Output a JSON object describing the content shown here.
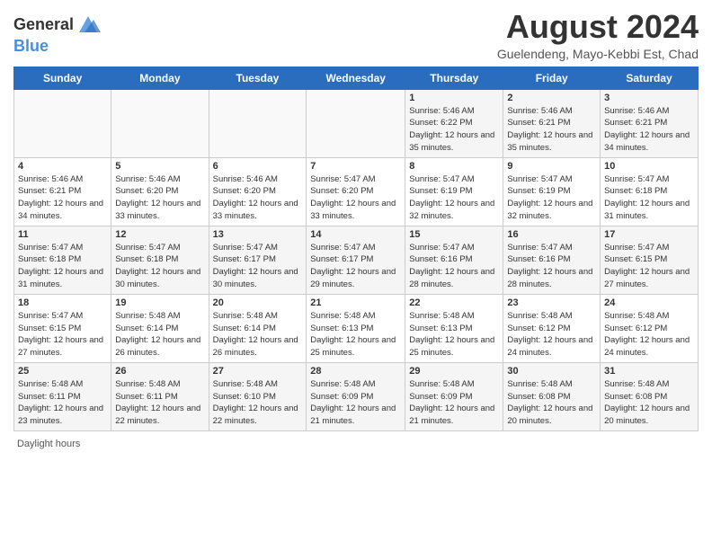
{
  "header": {
    "logo_line1": "General",
    "logo_line2": "Blue",
    "month": "August 2024",
    "location": "Guelendeng, Mayo-Kebbi Est, Chad"
  },
  "weekdays": [
    "Sunday",
    "Monday",
    "Tuesday",
    "Wednesday",
    "Thursday",
    "Friday",
    "Saturday"
  ],
  "weeks": [
    [
      {
        "day": "",
        "info": ""
      },
      {
        "day": "",
        "info": ""
      },
      {
        "day": "",
        "info": ""
      },
      {
        "day": "",
        "info": ""
      },
      {
        "day": "1",
        "info": "Sunrise: 5:46 AM\nSunset: 6:22 PM\nDaylight: 12 hours and 35 minutes."
      },
      {
        "day": "2",
        "info": "Sunrise: 5:46 AM\nSunset: 6:21 PM\nDaylight: 12 hours and 35 minutes."
      },
      {
        "day": "3",
        "info": "Sunrise: 5:46 AM\nSunset: 6:21 PM\nDaylight: 12 hours and 34 minutes."
      }
    ],
    [
      {
        "day": "4",
        "info": "Sunrise: 5:46 AM\nSunset: 6:21 PM\nDaylight: 12 hours and 34 minutes."
      },
      {
        "day": "5",
        "info": "Sunrise: 5:46 AM\nSunset: 6:20 PM\nDaylight: 12 hours and 33 minutes."
      },
      {
        "day": "6",
        "info": "Sunrise: 5:46 AM\nSunset: 6:20 PM\nDaylight: 12 hours and 33 minutes."
      },
      {
        "day": "7",
        "info": "Sunrise: 5:47 AM\nSunset: 6:20 PM\nDaylight: 12 hours and 33 minutes."
      },
      {
        "day": "8",
        "info": "Sunrise: 5:47 AM\nSunset: 6:19 PM\nDaylight: 12 hours and 32 minutes."
      },
      {
        "day": "9",
        "info": "Sunrise: 5:47 AM\nSunset: 6:19 PM\nDaylight: 12 hours and 32 minutes."
      },
      {
        "day": "10",
        "info": "Sunrise: 5:47 AM\nSunset: 6:18 PM\nDaylight: 12 hours and 31 minutes."
      }
    ],
    [
      {
        "day": "11",
        "info": "Sunrise: 5:47 AM\nSunset: 6:18 PM\nDaylight: 12 hours and 31 minutes."
      },
      {
        "day": "12",
        "info": "Sunrise: 5:47 AM\nSunset: 6:18 PM\nDaylight: 12 hours and 30 minutes."
      },
      {
        "day": "13",
        "info": "Sunrise: 5:47 AM\nSunset: 6:17 PM\nDaylight: 12 hours and 30 minutes."
      },
      {
        "day": "14",
        "info": "Sunrise: 5:47 AM\nSunset: 6:17 PM\nDaylight: 12 hours and 29 minutes."
      },
      {
        "day": "15",
        "info": "Sunrise: 5:47 AM\nSunset: 6:16 PM\nDaylight: 12 hours and 28 minutes."
      },
      {
        "day": "16",
        "info": "Sunrise: 5:47 AM\nSunset: 6:16 PM\nDaylight: 12 hours and 28 minutes."
      },
      {
        "day": "17",
        "info": "Sunrise: 5:47 AM\nSunset: 6:15 PM\nDaylight: 12 hours and 27 minutes."
      }
    ],
    [
      {
        "day": "18",
        "info": "Sunrise: 5:47 AM\nSunset: 6:15 PM\nDaylight: 12 hours and 27 minutes."
      },
      {
        "day": "19",
        "info": "Sunrise: 5:48 AM\nSunset: 6:14 PM\nDaylight: 12 hours and 26 minutes."
      },
      {
        "day": "20",
        "info": "Sunrise: 5:48 AM\nSunset: 6:14 PM\nDaylight: 12 hours and 26 minutes."
      },
      {
        "day": "21",
        "info": "Sunrise: 5:48 AM\nSunset: 6:13 PM\nDaylight: 12 hours and 25 minutes."
      },
      {
        "day": "22",
        "info": "Sunrise: 5:48 AM\nSunset: 6:13 PM\nDaylight: 12 hours and 25 minutes."
      },
      {
        "day": "23",
        "info": "Sunrise: 5:48 AM\nSunset: 6:12 PM\nDaylight: 12 hours and 24 minutes."
      },
      {
        "day": "24",
        "info": "Sunrise: 5:48 AM\nSunset: 6:12 PM\nDaylight: 12 hours and 24 minutes."
      }
    ],
    [
      {
        "day": "25",
        "info": "Sunrise: 5:48 AM\nSunset: 6:11 PM\nDaylight: 12 hours and 23 minutes."
      },
      {
        "day": "26",
        "info": "Sunrise: 5:48 AM\nSunset: 6:11 PM\nDaylight: 12 hours and 22 minutes."
      },
      {
        "day": "27",
        "info": "Sunrise: 5:48 AM\nSunset: 6:10 PM\nDaylight: 12 hours and 22 minutes."
      },
      {
        "day": "28",
        "info": "Sunrise: 5:48 AM\nSunset: 6:09 PM\nDaylight: 12 hours and 21 minutes."
      },
      {
        "day": "29",
        "info": "Sunrise: 5:48 AM\nSunset: 6:09 PM\nDaylight: 12 hours and 21 minutes."
      },
      {
        "day": "30",
        "info": "Sunrise: 5:48 AM\nSunset: 6:08 PM\nDaylight: 12 hours and 20 minutes."
      },
      {
        "day": "31",
        "info": "Sunrise: 5:48 AM\nSunset: 6:08 PM\nDaylight: 12 hours and 20 minutes."
      }
    ]
  ],
  "footer": "Daylight hours"
}
